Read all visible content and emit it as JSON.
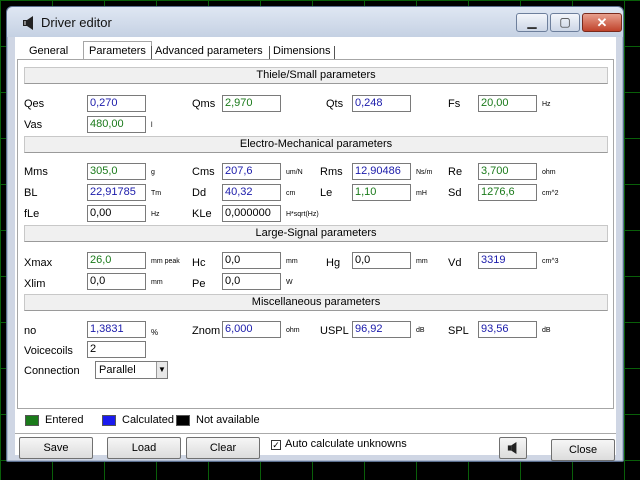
{
  "window": {
    "title": "Driver editor"
  },
  "tabs": [
    {
      "label": "General"
    },
    {
      "label": "Parameters"
    },
    {
      "label": "Advanced parameters"
    },
    {
      "label": "Dimensions"
    }
  ],
  "sections": {
    "ts": {
      "header": "Thiele/Small parameters",
      "qes": {
        "label": "Qes",
        "value": "0,270"
      },
      "qms": {
        "label": "Qms",
        "value": "2,970"
      },
      "qts": {
        "label": "Qts",
        "value": "0,248"
      },
      "fs": {
        "label": "Fs",
        "value": "20,00",
        "unit": "Hz"
      },
      "vas": {
        "label": "Vas",
        "value": "480,00",
        "unit": "l"
      }
    },
    "em": {
      "header": "Electro-Mechanical parameters",
      "mms": {
        "label": "Mms",
        "value": "305,0",
        "unit": "g"
      },
      "cms": {
        "label": "Cms",
        "value": "207,6",
        "unit": "um/N"
      },
      "rms": {
        "label": "Rms",
        "value": "12,90486",
        "unit": "Ns/m"
      },
      "re": {
        "label": "Re",
        "value": "3,700",
        "unit": "ohm"
      },
      "bl": {
        "label": "BL",
        "value": "22,91785",
        "unit": "Tm"
      },
      "dd": {
        "label": "Dd",
        "value": "40,32",
        "unit": "cm"
      },
      "le": {
        "label": "Le",
        "value": "1,10",
        "unit": "mH"
      },
      "sd": {
        "label": "Sd",
        "value": "1276,6",
        "unit": "cm^2"
      },
      "fle": {
        "label": "fLe",
        "value": "0,00",
        "unit": "Hz"
      },
      "kle": {
        "label": "KLe",
        "value": "0,000000",
        "unit": "H*sqrt(Hz)"
      }
    },
    "ls": {
      "header": "Large-Signal parameters",
      "xmax": {
        "label": "Xmax",
        "value": "26,0",
        "unit": "mm peak"
      },
      "hc": {
        "label": "Hc",
        "value": "0,0",
        "unit": "mm"
      },
      "hg": {
        "label": "Hg",
        "value": "0,0",
        "unit": "mm"
      },
      "vd": {
        "label": "Vd",
        "value": "3319",
        "unit": "cm^3"
      },
      "xlim": {
        "label": "Xlim",
        "value": "0,0",
        "unit": "mm"
      },
      "pe": {
        "label": "Pe",
        "value": "0,0",
        "unit": "W"
      }
    },
    "misc": {
      "header": "Miscellaneous parameters",
      "no": {
        "label": "no",
        "value": "1,3831",
        "unit": "%"
      },
      "znom": {
        "label": "Znom",
        "value": "6,000",
        "unit": "ohm"
      },
      "uspl": {
        "label": "USPL",
        "value": "96,92",
        "unit": "dB"
      },
      "spl": {
        "label": "SPL",
        "value": "93,56",
        "unit": "dB"
      },
      "voicecoils": {
        "label": "Voicecoils",
        "value": "2"
      },
      "connection": {
        "label": "Connection",
        "value": "Parallel"
      }
    }
  },
  "legend": [
    {
      "label": "Entered",
      "color": "#1a7a1a"
    },
    {
      "label": "Calculated",
      "color": "#1a1aee"
    },
    {
      "label": "Not available",
      "color": "#000000"
    }
  ],
  "buttons": {
    "save": "Save",
    "load": "Load",
    "clear": "Clear",
    "auto_calc": "Auto calculate unknowns",
    "close": "Close"
  },
  "auto_calc_checked": true
}
